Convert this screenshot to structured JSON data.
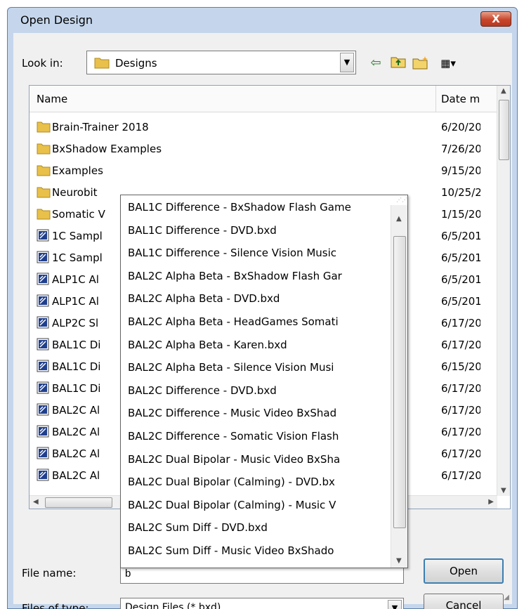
{
  "window": {
    "title": "Open Design",
    "close_glyph": "X"
  },
  "lookin": {
    "label": "Look in:",
    "value": "Designs",
    "icon": "folder-icon"
  },
  "toolbar": {
    "back": "⇦",
    "up": "📁",
    "newfolder": "📂",
    "views": "▦▾"
  },
  "list": {
    "columns": {
      "name": "Name",
      "date": "Date mo"
    },
    "rows": [
      {
        "name": "Brain-Trainer 2018",
        "date": "6/20/20",
        "kind": "folder"
      },
      {
        "name": "BxShadow Examples",
        "date": "7/26/20",
        "kind": "folder"
      },
      {
        "name": "Examples",
        "date": "9/15/20",
        "kind": "folder"
      },
      {
        "name": "Neurobit",
        "date": "10/25/2",
        "kind": "folder"
      },
      {
        "name": "Somatic V",
        "date": "1/15/20",
        "kind": "folder"
      },
      {
        "name": "1C Sampl",
        "date": "6/5/201",
        "kind": "file"
      },
      {
        "name": "1C Sampl",
        "date": "6/5/201",
        "kind": "file"
      },
      {
        "name": "ALP1C Al",
        "date": "6/5/201",
        "kind": "file"
      },
      {
        "name": "ALP1C Al",
        "date": "6/5/201",
        "kind": "file"
      },
      {
        "name": "ALP2C Sl",
        "date": "6/17/20",
        "kind": "file"
      },
      {
        "name": "BAL1C Di",
        "date": "6/17/20",
        "kind": "file"
      },
      {
        "name": "BAL1C Di",
        "date": "6/15/20",
        "kind": "file"
      },
      {
        "name": "BAL1C Di",
        "date": "6/17/20",
        "kind": "file"
      },
      {
        "name": "BAL2C Al",
        "date": "6/17/20",
        "kind": "file"
      },
      {
        "name": "BAL2C Al",
        "date": "6/17/20",
        "kind": "file"
      },
      {
        "name": "BAL2C Al",
        "date": "6/17/20",
        "kind": "file"
      },
      {
        "name": "BAL2C Al",
        "date": "6/17/20",
        "kind": "file"
      }
    ]
  },
  "autocomplete": {
    "items": [
      "BAL1C Difference - BxShadow Flash Game",
      "BAL1C Difference - DVD.bxd",
      "BAL1C Difference - Silence Vision Music",
      "BAL2C Alpha Beta - BxShadow Flash Gar",
      "BAL2C Alpha Beta - DVD.bxd",
      "BAL2C Alpha Beta - HeadGames Somati",
      "BAL2C Alpha Beta - Karen.bxd",
      "BAL2C Alpha Beta - Silence Vision Musi",
      "BAL2C Difference - DVD.bxd",
      "BAL2C Difference - Music Video BxShad",
      "BAL2C Difference - Somatic Vision Flash",
      "BAL2C Dual Bipolar - Music Video BxSha",
      "BAL2C Dual Bipolar (Calming) - DVD.bx",
      "BAL2C Dual Bipolar (Calming) - Music V",
      "BAL2C Sum Diff - DVD.bxd",
      "BAL2C Sum Diff - Music Video BxShado"
    ]
  },
  "filename": {
    "label": "File name:",
    "value": "b"
  },
  "filetype": {
    "label": "Files of type:",
    "value": "Design Files (*.bxd)"
  },
  "buttons": {
    "open": "Open",
    "cancel": "Cancel"
  },
  "colors": {
    "folder": "#e8c04a",
    "file_icon": "#1f3f8f",
    "accent": "#3c7fb1"
  }
}
